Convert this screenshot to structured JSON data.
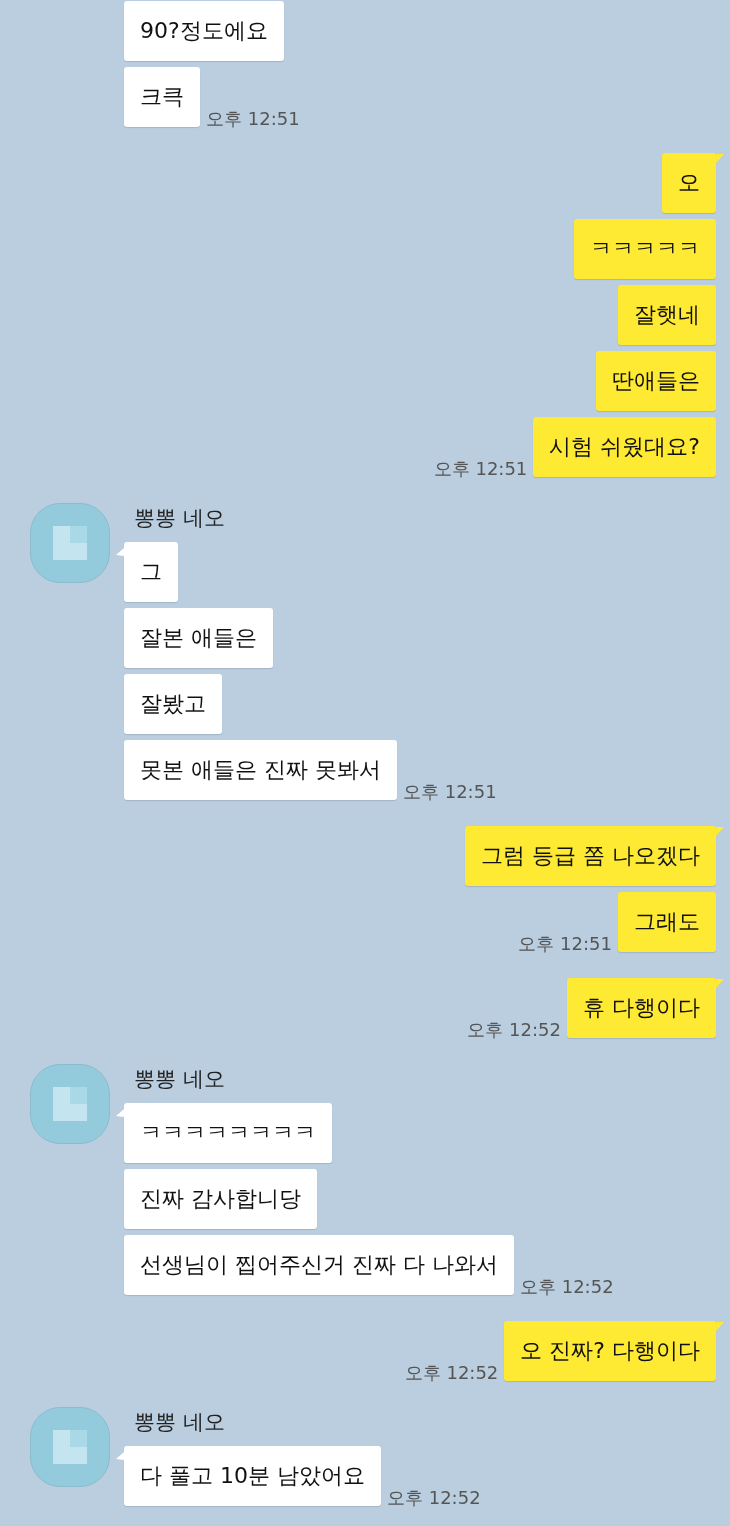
{
  "groups": [
    {
      "kind": "received",
      "messages": [
        "90?정도에요",
        "크큭"
      ],
      "time": "오후 12:51"
    },
    {
      "kind": "sent",
      "messages": [
        "오",
        "ㅋㅋㅋㅋㅋ",
        "잘햇네",
        "딴애들은",
        "시험 쉬웠대요?"
      ],
      "time": "오후 12:51"
    },
    {
      "kind": "received",
      "name": "뽕뽕 네오",
      "messages": [
        "그",
        "잘본 애들은",
        "잘봤고",
        "못본 애들은 진짜 못봐서"
      ],
      "time": "오후 12:51"
    },
    {
      "kind": "sent",
      "messages": [
        "그럼 등급 쫌 나오겠다",
        "그래도"
      ],
      "time": "오후 12:51"
    },
    {
      "kind": "sent",
      "messages": [
        "휴 다행이다"
      ],
      "time": "오후 12:52"
    },
    {
      "kind": "received",
      "name": "뽕뽕 네오",
      "messages": [
        "ㅋㅋㅋㅋㅋㅋㅋㅋ",
        "진짜 감사합니당",
        "선생님이 찝어주신거 진짜 다 나와서"
      ],
      "time": "오후 12:52"
    },
    {
      "kind": "sent",
      "messages": [
        "오 진짜? 다행이다"
      ],
      "time": "오후 12:52"
    },
    {
      "kind": "received",
      "name": "뽕뽕 네오",
      "messages": [
        "다 풀고 10분 남았어요"
      ],
      "time": "오후 12:52"
    }
  ]
}
